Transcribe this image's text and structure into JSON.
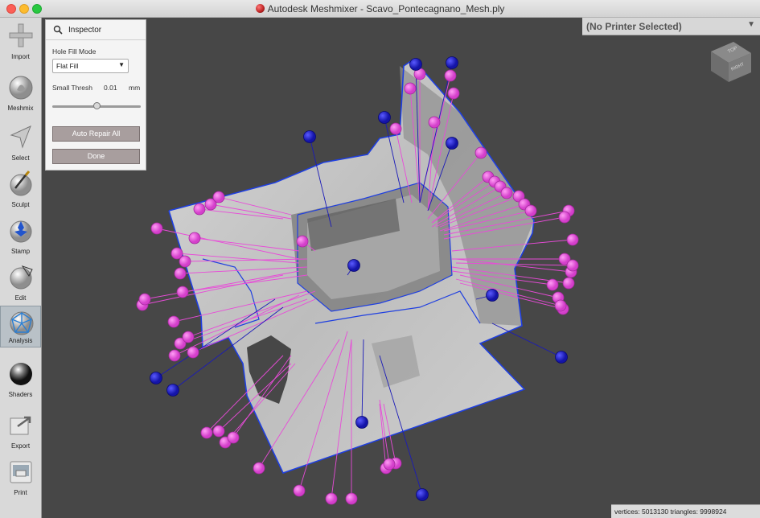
{
  "window": {
    "title": "Autodesk Meshmixer - Scavo_Pontecagnano_Mesh.ply",
    "icons": {
      "close": "close-traffic-light",
      "minimize": "minimize-traffic-light",
      "maximize": "maximize-traffic-light",
      "app": "meshmixer-app-icon"
    }
  },
  "toolbar": {
    "items": [
      {
        "label": "Import",
        "icon": "plus-icon"
      },
      {
        "label": "Meshmix",
        "icon": "meshmix-bunny-icon"
      },
      {
        "label": "Select",
        "icon": "cursor-arrow-icon"
      },
      {
        "label": "Sculpt",
        "icon": "sculpt-brush-icon"
      },
      {
        "label": "Stamp",
        "icon": "stamp-icon"
      },
      {
        "label": "Edit",
        "icon": "edit-sphere-icon"
      },
      {
        "label": "Analysis",
        "icon": "analysis-mesh-icon",
        "active": true
      },
      {
        "label": "Shaders",
        "icon": "shader-sphere-icon"
      },
      {
        "label": "Export",
        "icon": "export-icon"
      },
      {
        "label": "Print",
        "icon": "printer-icon"
      }
    ]
  },
  "inspector": {
    "title": "Inspector",
    "hole_fill_mode_label": "Hole Fill Mode",
    "hole_fill_mode_value": "Flat Fill",
    "small_thresh_label": "Small Thresh",
    "small_thresh_value": "0.01",
    "small_thresh_unit": "mm",
    "small_thresh_slider_fraction": 0.5,
    "auto_repair_label": "Auto Repair All",
    "done_label": "Done"
  },
  "printer": {
    "label": "(No Printer Selected)"
  },
  "view_cube": {
    "top": "TOP",
    "right": "RIGHT"
  },
  "status": {
    "text": "vertices: 5013130 triangles: 9998924"
  },
  "colors": {
    "mesh_surface": "#c4c4c4",
    "boundary_edge": "#1f3fe0",
    "non_manifold_marker": "#e84bd8",
    "hole_marker": "#1a1ab8",
    "viewport_bg": "#474747"
  }
}
